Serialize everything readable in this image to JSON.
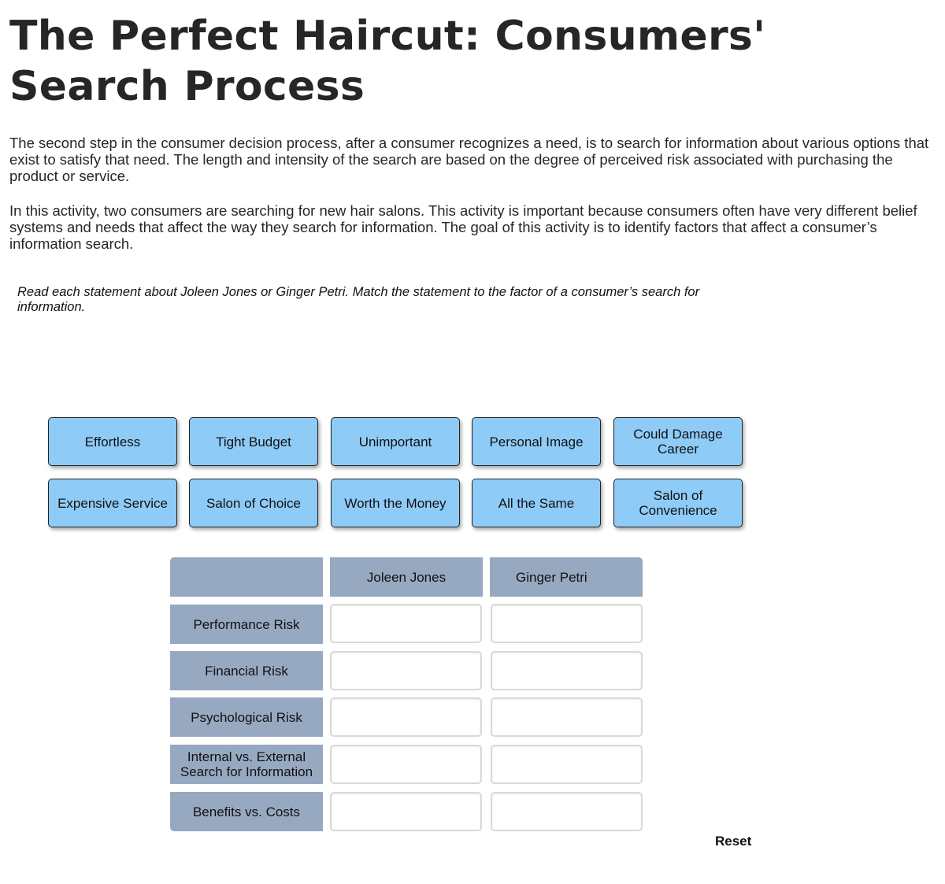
{
  "title": "The Perfect Haircut: Consumers' Search Process",
  "intro_paragraphs": [
    "The second step in the consumer decision process, after a consumer recognizes a need, is to search for information about various options that exist to satisfy that need. The length and intensity of the search are based on the degree of perceived risk associated with purchasing the product or service.",
    "In this activity, two consumers are searching for new hair salons. This activity is important because consumers often have very different belief systems and needs that affect the way they search for information. The goal of this activity is to identify factors that affect a consumer’s information search."
  ],
  "instructions": "Read each statement about Joleen Jones or Ginger Petri. Match the statement to the factor of a consumer’s search for information.",
  "tiles": [
    "Effortless",
    "Tight Budget",
    "Unimportant",
    "Personal Image",
    "Could Damage Career",
    "Expensive Service",
    "Salon of Choice",
    "Worth the Money",
    "All the Same",
    "Salon of Convenience"
  ],
  "table": {
    "columns": [
      "",
      "Joleen Jones",
      "Ginger Petri"
    ],
    "rows": [
      {
        "label": "Performance Risk",
        "joleen": "",
        "ginger": ""
      },
      {
        "label": "Financial Risk",
        "joleen": "",
        "ginger": ""
      },
      {
        "label": "Psychological Risk",
        "joleen": "",
        "ginger": ""
      },
      {
        "label": "Internal vs. External Search for Information",
        "joleen": "",
        "ginger": ""
      },
      {
        "label": "Benefits vs. Costs",
        "joleen": "",
        "ginger": ""
      }
    ]
  },
  "reset_label": "Reset",
  "colors": {
    "tile": "#8fcbf7",
    "header": "#97a9c1"
  }
}
